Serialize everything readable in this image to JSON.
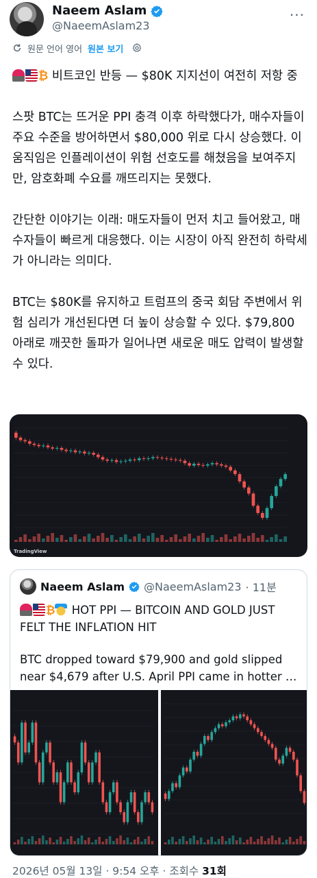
{
  "author": {
    "name": "Naeem Aslam",
    "handle": "@NaeemAslam23",
    "more": "···"
  },
  "translate": {
    "original_lang": "원문 언어 영어",
    "show_original": "원본 보기"
  },
  "post": {
    "title_prefix_btc": "₿",
    "title": "비트코인 반등 — $80K 지지선이 여전히 저항 중",
    "paragraphs": [
      "스팟 BTC는 뜨거운 PPI 충격 이후 하락했다가, 매수자들이 주요 수준을 방어하면서 $80,000 위로 다시 상승했다. 이 움직임은 인플레이션이 위험 선호도를 해쳤음을 보여주지만, 암호화폐 수요를 깨뜨리지는 못했다.",
      "간단한 이야기는 이래: 매도자들이 먼저 치고 들어왔고, 매수자들이 빠르게 대응했다. 이는 시장이 아직 완전히 하락세가 아니라는 의미다.",
      "BTC는 $80K를 유지하고 트럼프의 중국 회담 주변에서 위험 심리가 개선된다면 더 높이 상승할 수 있다. $79,800 아래로 깨끗한 돌파가 일어나면 새로운 매도 압력이 발생할 수 있다."
    ],
    "chart_logo": "TradingView"
  },
  "quote": {
    "name": "Naeem Aslam",
    "handle": "@NaeemAslam23",
    "time": "· 11분",
    "title_btc": "₿",
    "title": "HOT PPI — BITCOIN AND GOLD JUST FELT THE INFLATION HIT",
    "body_line1": "BTC dropped toward $79,900 and gold slipped",
    "body_line2": "near $4,679 after U.S. April PPI came in hotter t..."
  },
  "footer": {
    "date": "2026년 05월 13일 · 9:54 오후 · 조회수 ",
    "views": "31회"
  },
  "colors": {
    "accent": "#1d9bf0",
    "up": "#26a69a",
    "down": "#ef5350",
    "chart_bg": "#14161c"
  },
  "chart_data": [
    {
      "type": "candlestick",
      "title": "",
      "close": [
        81.6,
        81.4,
        81.3,
        81.1,
        81.0,
        80.9,
        80.95,
        80.8,
        80.7,
        80.75,
        80.6,
        80.5,
        80.55,
        80.4,
        80.45,
        80.3,
        80.35,
        80.2,
        80.0,
        79.8,
        79.7,
        79.75,
        79.6,
        79.65,
        79.7,
        79.8,
        79.75,
        79.9,
        79.85,
        79.9,
        80.0,
        79.95,
        79.9,
        79.85,
        79.8,
        79.75,
        79.7,
        79.5,
        79.3,
        79.45,
        79.35,
        79.3,
        79.4,
        79.5,
        79.4,
        79.3,
        79.2,
        78.9,
        78.6,
        78.0,
        77.5,
        77.0,
        76.0,
        75.4,
        75.0,
        75.8,
        76.8,
        77.6,
        78.2,
        78.6
      ]
    },
    {
      "type": "candlestick",
      "title": "",
      "close": [
        3.2,
        3.1,
        3.3,
        3.15,
        3.2,
        3.3,
        3.1,
        3.0,
        3.15,
        3.2,
        3.1,
        3.0,
        3.05,
        2.9,
        3.0,
        3.1,
        3.0,
        2.95,
        3.05,
        3.2,
        3.1,
        3.0,
        3.1,
        3.15,
        3.0,
        2.9,
        2.85,
        2.95,
        3.0,
        2.9,
        2.85,
        2.8,
        2.9,
        2.95,
        2.85,
        2.8,
        2.9,
        2.95,
        2.9,
        2.85
      ]
    },
    {
      "type": "candlestick",
      "title": "",
      "close": [
        4.0,
        4.2,
        4.4,
        4.3,
        4.6,
        4.8,
        4.7,
        5.0,
        5.2,
        5.1,
        5.4,
        5.6,
        5.5,
        5.7,
        5.8,
        5.9,
        5.85,
        5.95,
        6.0,
        6.1,
        6.05,
        6.15,
        6.1,
        6.0,
        5.9,
        5.8,
        5.7,
        5.6,
        5.5,
        5.4,
        5.3,
        5.0,
        4.9,
        5.1,
        5.3,
        5.2,
        5.0,
        4.6,
        4.2,
        3.9
      ]
    }
  ]
}
